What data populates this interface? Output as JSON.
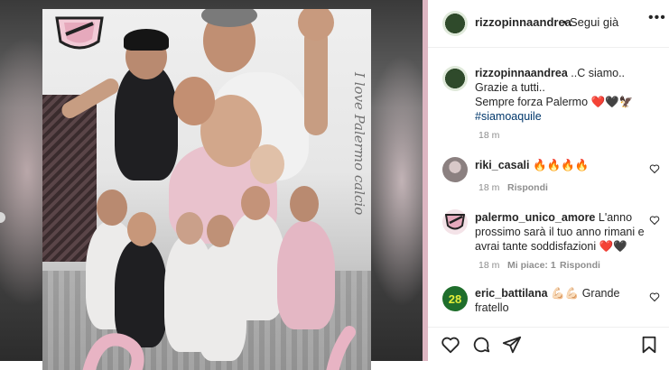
{
  "post": {
    "slogan": "I love Palermo calcio"
  },
  "header": {
    "username": "rizzopinnaandrea",
    "separator": "•",
    "follow_label": "Segui già",
    "more_icon": "more-horizontal-icon"
  },
  "caption": {
    "username": "rizzopinnaandrea",
    "line1": "..C siamo..",
    "line2": "Grazie a tutti..",
    "line3": "Sempre forza Palermo",
    "emojis": "❤️🖤🦅",
    "hashtag": "#siamoaquile",
    "time": "18 m"
  },
  "comments": [
    {
      "username": "riki_casali",
      "text": "🔥🔥🔥🔥",
      "time": "18 m",
      "reply_label": "Rispondi"
    },
    {
      "username": "palermo_unico_amore",
      "text": "L'anno prossimo sarà il tuo anno rimani e avrai tante soddisfazioni",
      "emojis": "❤️🖤",
      "time": "18 m",
      "likes_label": "Mi piace: 1",
      "reply_label": "Rispondi"
    },
    {
      "username": "eric_battilana",
      "emojis": "💪🏻💪🏻",
      "text": "Grande fratello"
    }
  ],
  "actions": {
    "like_icon": "heart-outline-icon",
    "comment_icon": "comment-bubble-icon",
    "share_icon": "paper-plane-icon",
    "save_icon": "bookmark-icon"
  },
  "colors": {
    "pink_accent": "#e8b4c4",
    "link": "#00376b",
    "meta_gray": "#8e8e8e"
  }
}
